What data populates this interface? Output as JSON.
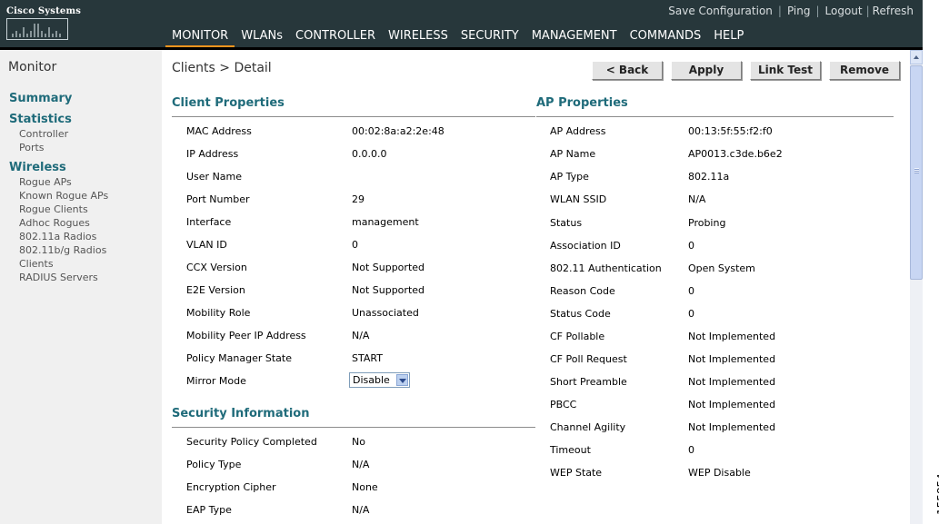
{
  "logo": {
    "text": "Cisco Systems"
  },
  "header": {
    "utility_links": [
      "Save Configuration",
      "Ping",
      "Logout",
      "Refresh"
    ],
    "nav_tabs": [
      "MONITOR",
      "WLANs",
      "CONTROLLER",
      "WIRELESS",
      "SECURITY",
      "MANAGEMENT",
      "COMMANDS",
      "HELP"
    ],
    "active_tab": "MONITOR",
    "active_color": "#f7941d"
  },
  "sidebar": {
    "title": "Monitor",
    "summary": "Summary",
    "statistics": {
      "label": "Statistics",
      "items": [
        "Controller",
        "Ports"
      ]
    },
    "wireless": {
      "label": "Wireless",
      "items": [
        "Rogue APs",
        "Known Rogue APs",
        "Rogue Clients",
        "Adhoc Rogues",
        "802.11a Radios",
        "802.11b/g Radios",
        "Clients",
        "RADIUS Servers"
      ]
    }
  },
  "page": {
    "breadcrumb": "Clients > Detail",
    "buttons": {
      "back": "< Back",
      "apply": "Apply",
      "link_test": "Link Test",
      "remove": "Remove"
    }
  },
  "client_properties": {
    "heading": "Client Properties",
    "rows": [
      {
        "label": "MAC Address",
        "value": "00:02:8a:a2:2e:48"
      },
      {
        "label": "IP Address",
        "value": "0.0.0.0"
      },
      {
        "label": "User Name",
        "value": ""
      },
      {
        "label": "Port Number",
        "value": "29"
      },
      {
        "label": "Interface",
        "value": "management"
      },
      {
        "label": "VLAN ID",
        "value": "0"
      },
      {
        "label": "CCX Version",
        "value": "Not Supported"
      },
      {
        "label": "E2E Version",
        "value": "Not Supported"
      },
      {
        "label": "Mobility Role",
        "value": "Unassociated"
      },
      {
        "label": "Mobility Peer IP Address",
        "value": "N/A"
      },
      {
        "label": "Policy Manager State",
        "value": "START"
      }
    ],
    "mirror_mode": {
      "label": "Mirror Mode",
      "value": "Disable"
    }
  },
  "security_information": {
    "heading": "Security Information",
    "rows": [
      {
        "label": "Security Policy Completed",
        "value": "No"
      },
      {
        "label": "Policy Type",
        "value": "N/A"
      },
      {
        "label": "Encryption Cipher",
        "value": "None"
      },
      {
        "label": "EAP Type",
        "value": "N/A"
      }
    ]
  },
  "ap_properties": {
    "heading": "AP Properties",
    "rows": [
      {
        "label": "AP Address",
        "value": "00:13:5f:55:f2:f0"
      },
      {
        "label": "AP Name",
        "value": "AP0013.c3de.b6e2"
      },
      {
        "label": "AP Type",
        "value": "802.11a"
      },
      {
        "label": "WLAN SSID",
        "value": "N/A"
      },
      {
        "label": "Status",
        "value": "Probing"
      },
      {
        "label": "Association ID",
        "value": "0"
      },
      {
        "label": "802.11 Authentication",
        "value": "Open System"
      },
      {
        "label": "Reason Code",
        "value": "0"
      },
      {
        "label": "Status Code",
        "value": "0"
      },
      {
        "label": "CF Pollable",
        "value": "Not Implemented"
      },
      {
        "label": "CF Poll Request",
        "value": "Not Implemented"
      },
      {
        "label": "Short Preamble",
        "value": "Not Implemented"
      },
      {
        "label": "PBCC",
        "value": "Not Implemented"
      },
      {
        "label": "Channel Agility",
        "value": "Not Implemented"
      },
      {
        "label": "Timeout",
        "value": "0"
      },
      {
        "label": "WEP State",
        "value": "WEP Disable"
      }
    ]
  },
  "figure_id": "155854"
}
